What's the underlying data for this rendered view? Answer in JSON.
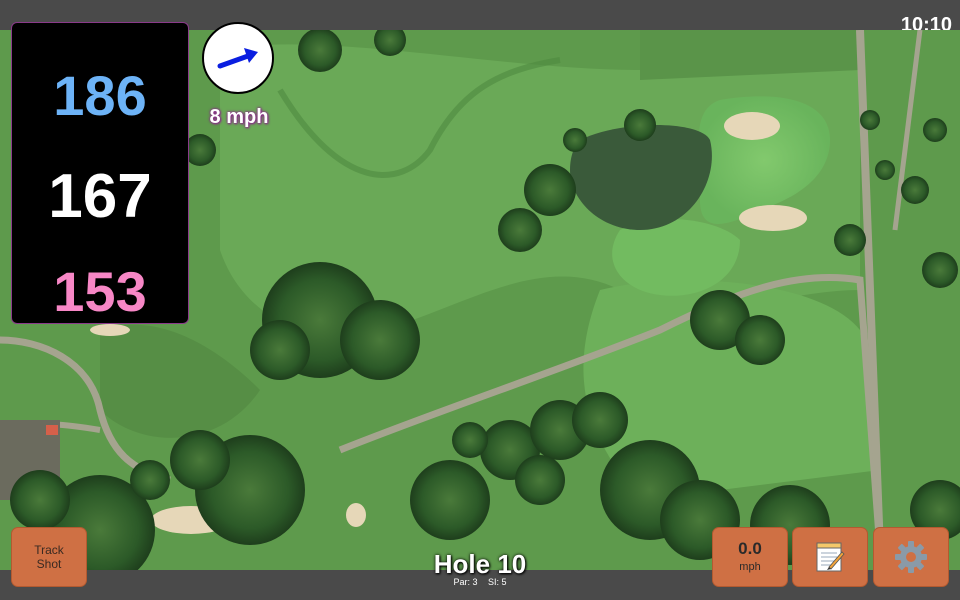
{
  "status_bar": {
    "time": "10:10"
  },
  "distances": {
    "back": "186",
    "center": "167",
    "front": "153"
  },
  "wind": {
    "speed_label": "8 mph",
    "icon": "arrow-icon"
  },
  "buttons": {
    "track_shot_line1": "Track",
    "track_shot_line2": "Shot",
    "speed_value": "0.0",
    "speed_unit": "mph",
    "notes_icon": "notepad-icon",
    "settings_icon": "gear-icon"
  },
  "hole": {
    "title": "Hole 10",
    "par": "Par: 3",
    "si": "SI: 5"
  },
  "colors": {
    "back": "#6db3f7",
    "center": "#ffffff",
    "front": "#f787c6",
    "button": "#cf7044"
  }
}
